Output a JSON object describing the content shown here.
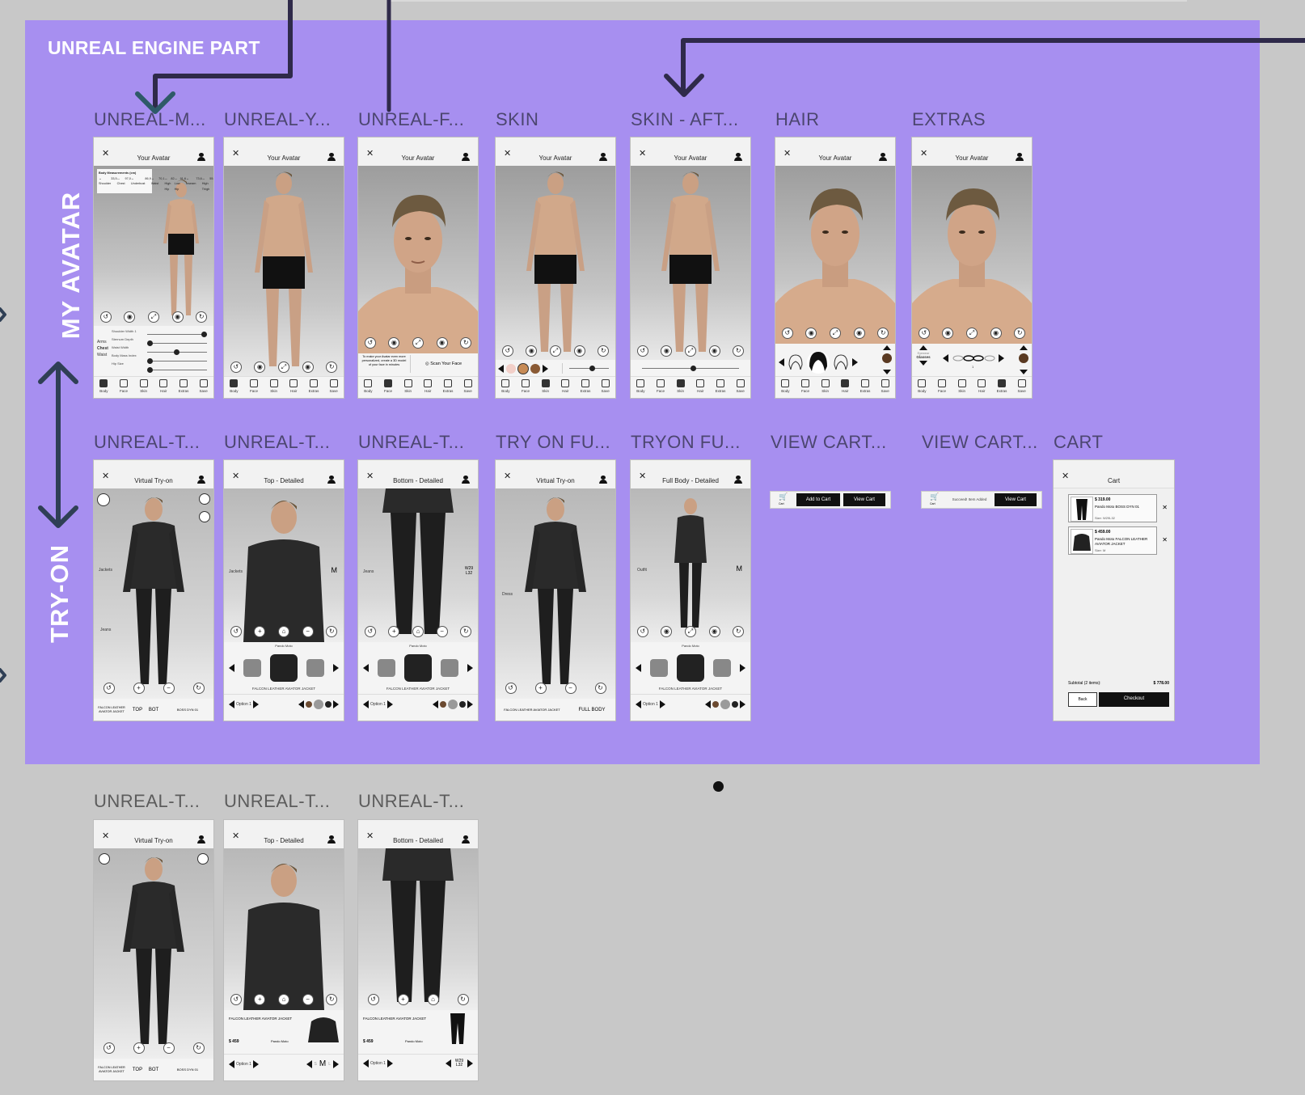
{
  "region": {
    "title": "UNREAL ENGINE PART",
    "color": "#a78ff0"
  },
  "rows": {
    "avatar": "MY AVATAR",
    "tryon": "TRY-ON"
  },
  "frames_row1": [
    {
      "label": "UNREAL-M...",
      "screen": "measure"
    },
    {
      "label": "UNREAL-Y...",
      "screen": "body"
    },
    {
      "label": "UNREAL-F...",
      "screen": "face"
    },
    {
      "label": "SKIN",
      "screen": "skin"
    },
    {
      "label": "SKIN - AFT...",
      "screen": "skin2"
    },
    {
      "label": "HAIR",
      "screen": "hair"
    },
    {
      "label": "EXTRAS",
      "screen": "extras"
    }
  ],
  "frames_row2": [
    {
      "label": "UNREAL-T...",
      "title": "Virtual Try-on"
    },
    {
      "label": "UNREAL-T...",
      "title": "Top - Detailed"
    },
    {
      "label": "UNREAL-T...",
      "title": "Bottom - Detailed"
    },
    {
      "label": "TRY ON FU...",
      "title": "Virtual Try-on"
    },
    {
      "label": "TRYON FU...",
      "title": "Full Body - Detailed"
    },
    {
      "label": "VIEW CART...",
      "title": ""
    },
    {
      "label": "VIEW CART...",
      "title": ""
    },
    {
      "label": "CART",
      "title": "Cart"
    }
  ],
  "frames_row3": [
    {
      "label": "UNREAL-T...",
      "title": "Virtual Try-on"
    },
    {
      "label": "UNREAL-T...",
      "title": "Top - Detailed"
    },
    {
      "label": "UNREAL-T...",
      "title": "Bottom - Detailed"
    }
  ],
  "avatar_title": "Your Avatar",
  "tabs": [
    "Body",
    "Face",
    "Skin",
    "Hair",
    "Extras",
    "Save"
  ],
  "measurements": {
    "heading": "Body Measurements (cm)",
    "items": [
      [
        "Shoulder",
        "33,5"
      ],
      [
        "Chest",
        "97,0"
      ],
      [
        "Underbust",
        "86,9"
      ],
      [
        "Waist",
        "70,1"
      ],
      [
        "High Hip",
        "82"
      ],
      [
        "Low Hip",
        "91,6"
      ],
      [
        "Inseam",
        "73,6"
      ],
      [
        "High Thigh",
        "55,6"
      ],
      [
        "Mid Thigh",
        "49,5"
      ],
      [
        "Knee",
        "36"
      ],
      [
        "Calf",
        "36,1"
      ],
      [
        "Ankle",
        "19,9"
      ],
      [
        "Foot Length",
        "24,4"
      ],
      [
        "Foot Breadth",
        "8,9"
      ],
      [
        "Bicep",
        "32,1"
      ],
      [
        "Forearm",
        "26,0"
      ],
      [
        "Wrist",
        "15,9"
      ],
      [
        "Shoulder to Wrist",
        "56,7"
      ],
      [
        "Hand Length",
        "18,5"
      ],
      [
        "Hand Breadth",
        "8,1"
      ],
      [
        "Neck",
        "37,3"
      ],
      [
        "Head",
        "56,0"
      ],
      [
        "Height",
        "170,5"
      ]
    ]
  },
  "measure_sliders": {
    "side": [
      "Arms",
      "Chest",
      "Waist"
    ],
    "rows": [
      "Shoulder Width 1",
      "Sternum Depth",
      "Waist Width",
      "Body Mass Index",
      "Hip Size"
    ]
  },
  "face_panel": {
    "note": "To make your Avatar even more personalized, create a 3D model of your face in minutes",
    "scan": "Scan Your Face"
  },
  "extras_panel": {
    "category_top": "Eyewear",
    "category": "Glasses",
    "count": "1"
  },
  "swatch_colors": [
    "#f2cfc8",
    "#c78b56",
    "#8a5a34"
  ],
  "hair_color": "#5a3a22",
  "tryon": {
    "jackets": "Jackets",
    "jeans": "Jeans",
    "dress": "Dress",
    "outfit": "Outfit",
    "brand": "Pando Moto",
    "product": "FALCON LEATHER AVIATOR JACKET",
    "tab_top": "TOP",
    "tab_bot": "BOT",
    "bot_item": "BOSS DYN 01",
    "full_body": "FULL BODY",
    "option": "Option 1",
    "size_top": "M",
    "size_bot": "W29 L32",
    "price": "$ 459",
    "sizes": [
      "S",
      "M",
      "L"
    ],
    "color_swatches": [
      "#6b4a30",
      "#9a9a9a",
      "#222222"
    ]
  },
  "view_cart": {
    "add": "Add to Cart",
    "view": "View Cart",
    "cart": "Cart",
    "success": "Succeed! Item Added"
  },
  "cart": {
    "title": "Cart",
    "items": [
      {
        "price": "$ 319.00",
        "name": "Pando Moto BOSS DYN 01",
        "size": "Size: W29L32"
      },
      {
        "price": "$ 459.00",
        "name": "Pando Moto FALCON LEATHER AVIATOR JACKET",
        "size": "Size: M"
      }
    ],
    "subtotal_label": "Subtotal (2 items):",
    "subtotal": "$ 778.00",
    "back": "Back",
    "checkout": "Checkout"
  }
}
